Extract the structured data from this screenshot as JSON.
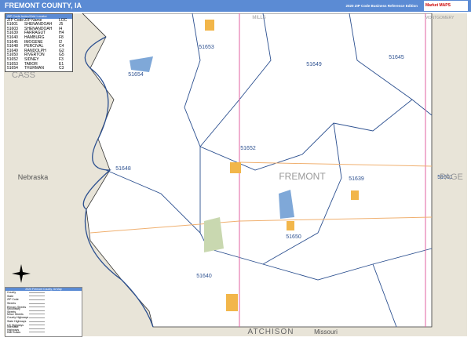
{
  "header": {
    "title": "FREMONT COUNTY, IA",
    "edition": "2020 ZIP Code Business Reference Edition",
    "logo": "Market MAPS"
  },
  "zip_table": {
    "title": "ZIP Code Index/Grid Locator",
    "columns": [
      "ZIP Code",
      "ZIP Name",
      "LOC"
    ],
    "rows": [
      [
        "51601",
        "SHENANDOAH",
        "J5"
      ],
      [
        "51603",
        "SHENANDOAH",
        "I4"
      ],
      [
        "51639",
        "FARRAGUT",
        "H4"
      ],
      [
        "51640",
        "HAMBURG",
        "F8"
      ],
      [
        "51645",
        "IMOGENE",
        "I2"
      ],
      [
        "51648",
        "PERCIVAL",
        "C4"
      ],
      [
        "51649",
        "RANDOLPH",
        "G2"
      ],
      [
        "51650",
        "RIVERTON",
        "G5"
      ],
      [
        "51652",
        "SIDNEY",
        "F3"
      ],
      [
        "51653",
        "TABOR",
        "E1"
      ],
      [
        "51654",
        "THURMAN",
        "C3"
      ]
    ]
  },
  "map": {
    "county": "FREMONT",
    "neighbors": {
      "north": "MILLS",
      "northeast": "MONTGOMERY",
      "east": "PAGE",
      "west": "CASS",
      "state_west": "Nebraska",
      "state_south": "Missouri",
      "south": "ATCHISON"
    },
    "zip_labels": [
      "51653",
      "51649",
      "51645",
      "51654",
      "51652",
      "51648",
      "51639",
      "51601",
      "51650",
      "51640"
    ],
    "colors": {
      "zip_boundary": "#2b4f8f",
      "land": "#ffffff",
      "outside": "#e8e4d8",
      "water": "#7fa8d8",
      "city": "#f2b64a",
      "park": "#c9d8b0",
      "highway": "#e060a0"
    }
  },
  "legend_key": {
    "title": "2020 Fremont County, IA Map",
    "items": [
      "County",
      "State",
      "ZIP Code",
      "Streets",
      "Primary Streets",
      "Secondary Streets",
      "Minor Streets",
      "County Highways",
      "State Highways",
      "US Highways",
      "Interstate Highways",
      "Rail Roads"
    ]
  }
}
